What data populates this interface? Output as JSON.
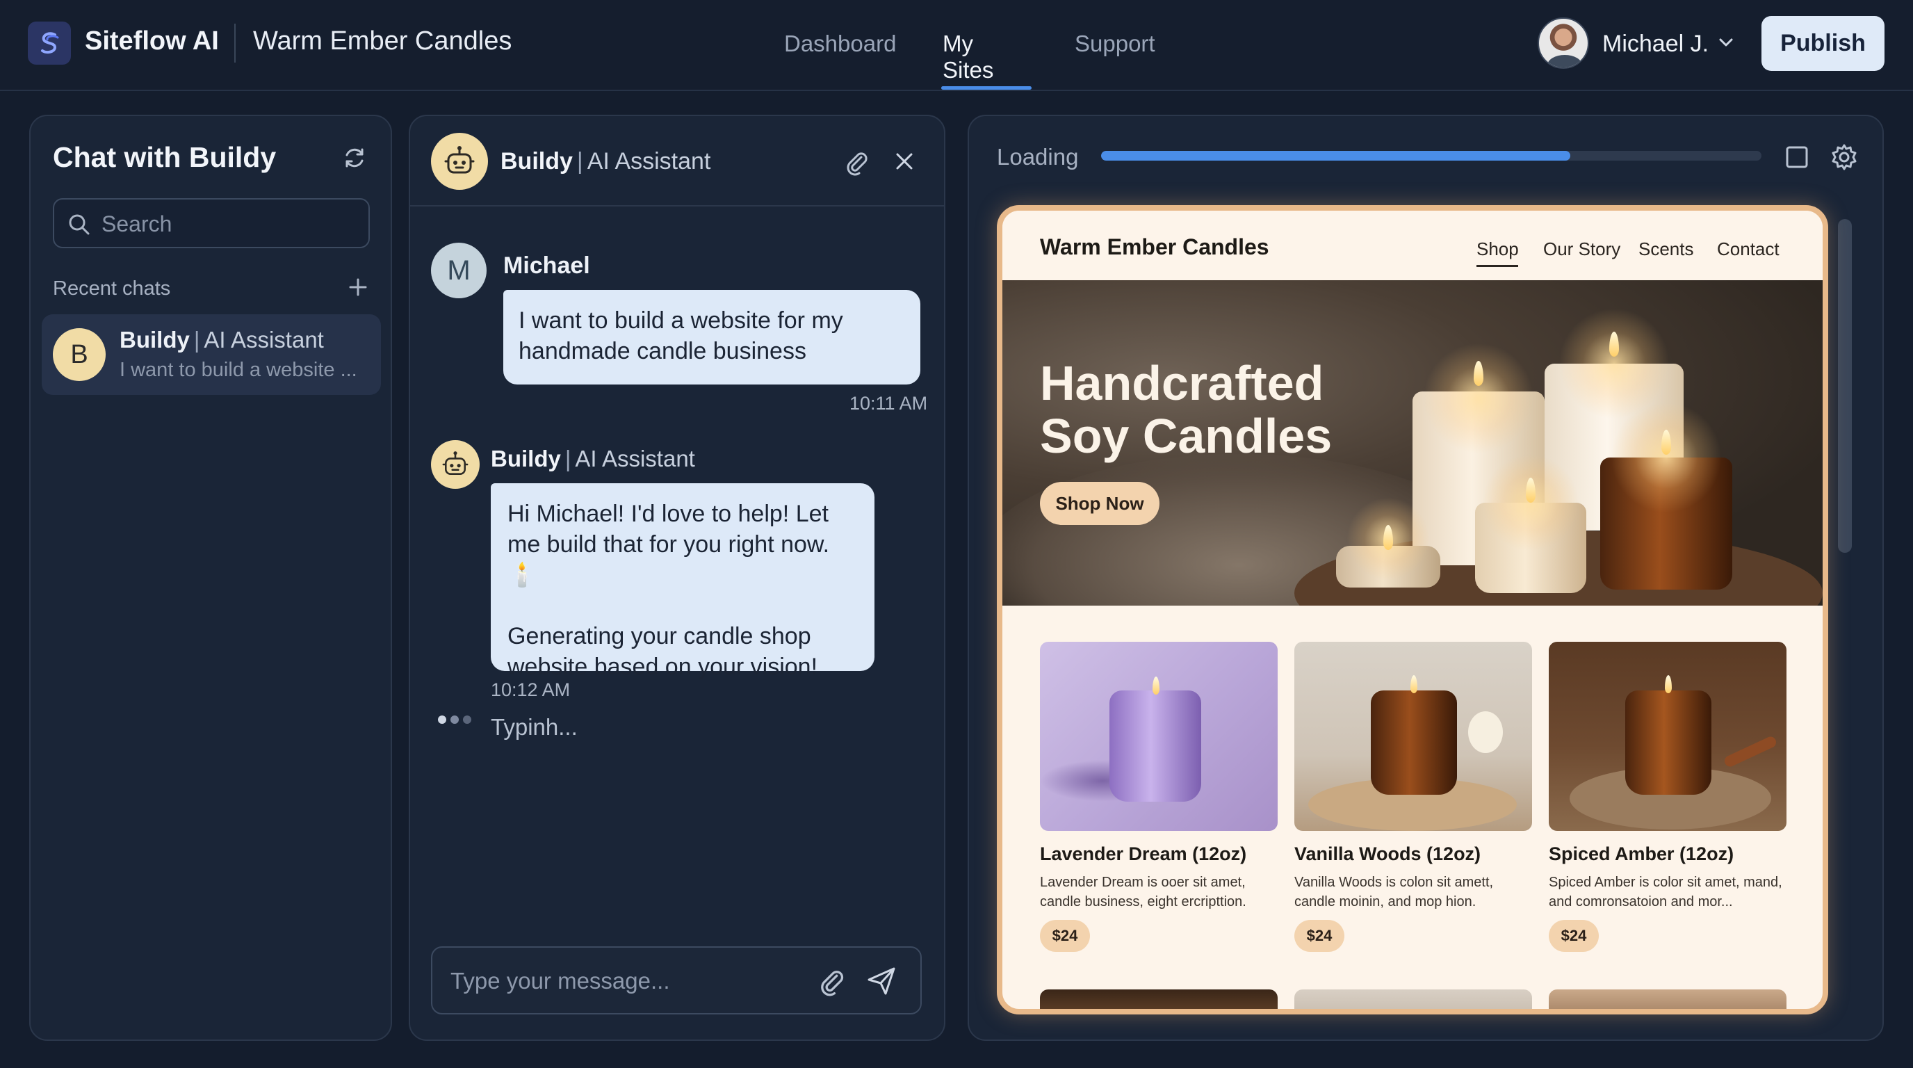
{
  "header": {
    "brand": "Siteflow AI",
    "project_title": "Warm Ember Candles",
    "nav": [
      "Dashboard",
      "My Sites",
      "Support"
    ],
    "active_nav": "My Sites",
    "user_name": "Michael J.",
    "publish_label": "Publish"
  },
  "sidebar": {
    "title": "Chat with Buildy",
    "search_placeholder": "Search",
    "recent_label": "Recent chats",
    "chats": [
      {
        "avatar_letter": "B",
        "name": "Buildy",
        "role": "AI Assistant",
        "preview": "I want to build a website ..."
      }
    ]
  },
  "chat": {
    "assistant_name": "Buildy",
    "assistant_role": "AI Assistant",
    "separator": "|",
    "messages": [
      {
        "sender": "Michael",
        "avatar_letter": "M",
        "text": "I want to build a website for my handmade candle business",
        "time": "10:11 AM"
      },
      {
        "sender": "Buildy",
        "role": "AI Assistant",
        "paragraphs": [
          "Hi Michael! I'd love to help! Let me build that for you right now. 🕯️",
          "Generating your candle shop website based on your vision!"
        ],
        "time": "10:12 AM"
      }
    ],
    "typing_text": "Typinh...",
    "composer_placeholder": "Type your message..."
  },
  "preview": {
    "loading_label": "Loading",
    "progress": 0.71,
    "site": {
      "brand": "Warm Ember Candles",
      "nav": [
        "Shop",
        "Our Story",
        "Scents",
        "Contact"
      ],
      "active_nav": "Shop",
      "hero_title_line1": "Handcrafted",
      "hero_title_line2": "Soy Candles",
      "hero_button": "Shop Now",
      "products": [
        {
          "name": "Lavender Dream (12oz)",
          "description": "Lavender Dream is ooer sit amet, candle business, eight ercripttion.",
          "price": "$24"
        },
        {
          "name": "Vanilla Woods (12oz)",
          "description": "Vanilla Woods is colon sit amett, candle moinin, and mop hion.",
          "price": "$24"
        },
        {
          "name": "Spiced Amber (12oz)",
          "description": "Spiced Amber is color sit amet, mand, and comronsatoion and mor...",
          "price": "$24"
        }
      ]
    }
  },
  "colors": {
    "background": "#141d2d",
    "panel": "#1a2537",
    "accent": "#4a8de8",
    "bubble": "#dde9f8",
    "preview_border": "#e8b98a",
    "price_badge": "#f3d3ae"
  },
  "icons": [
    "siteflow-logo-icon",
    "chevron-down-icon",
    "refresh-icon",
    "search-icon",
    "plus-icon",
    "robot-icon",
    "paperclip-icon",
    "close-icon",
    "send-icon",
    "square-icon",
    "gear-icon"
  ]
}
